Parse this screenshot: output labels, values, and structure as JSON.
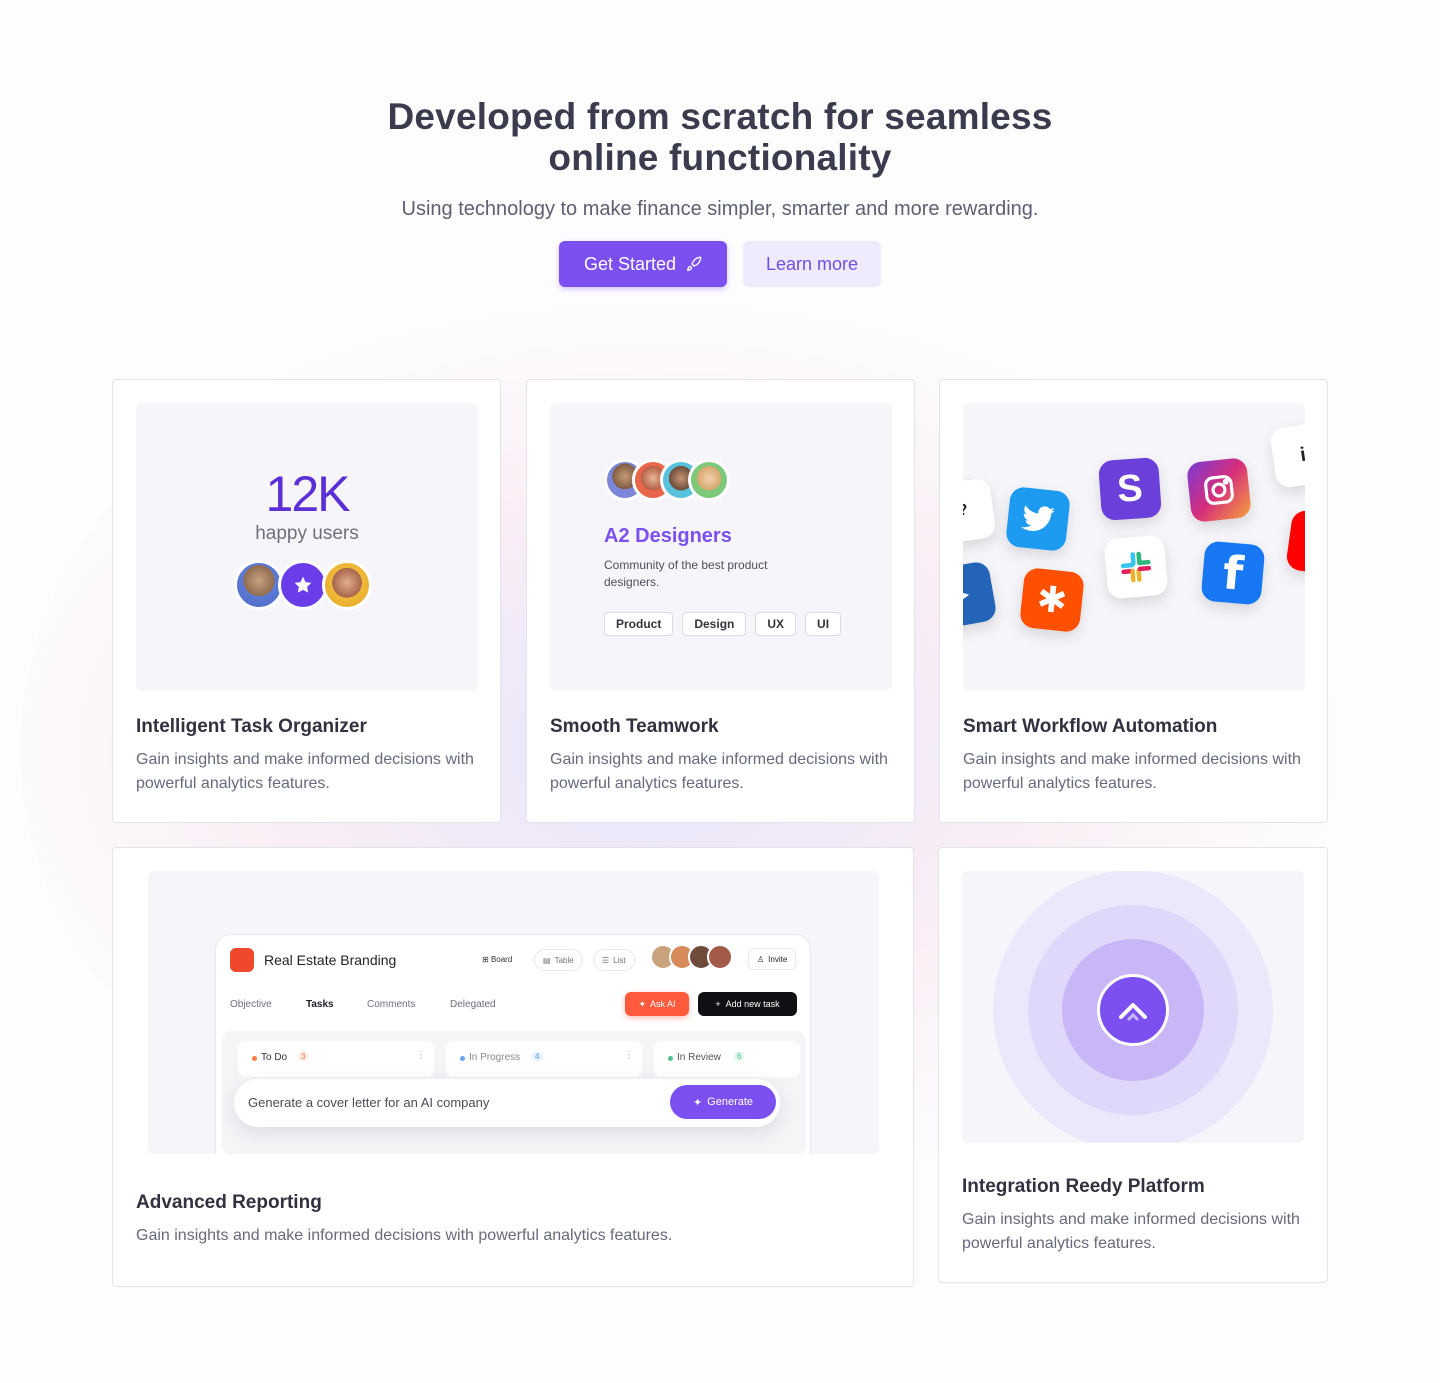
{
  "hero": {
    "title_line1": "Developed from scratch for seamless",
    "title_line2": "online functionality",
    "subtitle": "Using technology to make finance simpler, smarter and more rewarding.",
    "primary_button": "Get Started",
    "secondary_button": "Learn more"
  },
  "cards": {
    "task": {
      "stat": "12K",
      "stat_label": "happy users",
      "title": "Intelligent Task Organizer",
      "description": "Gain insights and make informed decisions with powerful analytics features."
    },
    "team": {
      "group_name": "A2 Designers",
      "group_desc": "Community of the best product designers.",
      "tags": [
        "Product",
        "Design",
        "UX",
        "UI"
      ],
      "title": "Smooth Teamwork",
      "description": "Gain insights and make informed decisions with powerful analytics features."
    },
    "workflow": {
      "apps": [
        "twitter-icon",
        "skype-icon",
        "instagram-icon",
        "zapier-icon",
        "slack-icon",
        "facebook-icon"
      ],
      "title": "Smart Workflow Automation",
      "description": "Gain insights and make informed decisions with powerful analytics features."
    },
    "reporting": {
      "project_title": "Real Estate Branding",
      "views": [
        "Board",
        "Table",
        "List"
      ],
      "invite": "Invite",
      "tabs": [
        "Objective",
        "Tasks",
        "Comments",
        "Delegated"
      ],
      "ask_ai": "Ask AI",
      "add_task": "Add new task",
      "columns": [
        {
          "name": "To Do",
          "count": "3"
        },
        {
          "name": "In Progress",
          "count": "4"
        },
        {
          "name": "In Review",
          "count": "6"
        }
      ],
      "prompt": "Generate a cover letter for an AI company",
      "generate": "Generate",
      "title": "Advanced Reporting",
      "description": "Gain insights and make informed decisions with powerful analytics features."
    },
    "integration": {
      "title": "Integration Reedy Platform",
      "description": "Gain insights and make informed decisions with powerful analytics features."
    }
  },
  "colors": {
    "accent": "#7b4ff0",
    "accent_light": "#efeafd"
  }
}
